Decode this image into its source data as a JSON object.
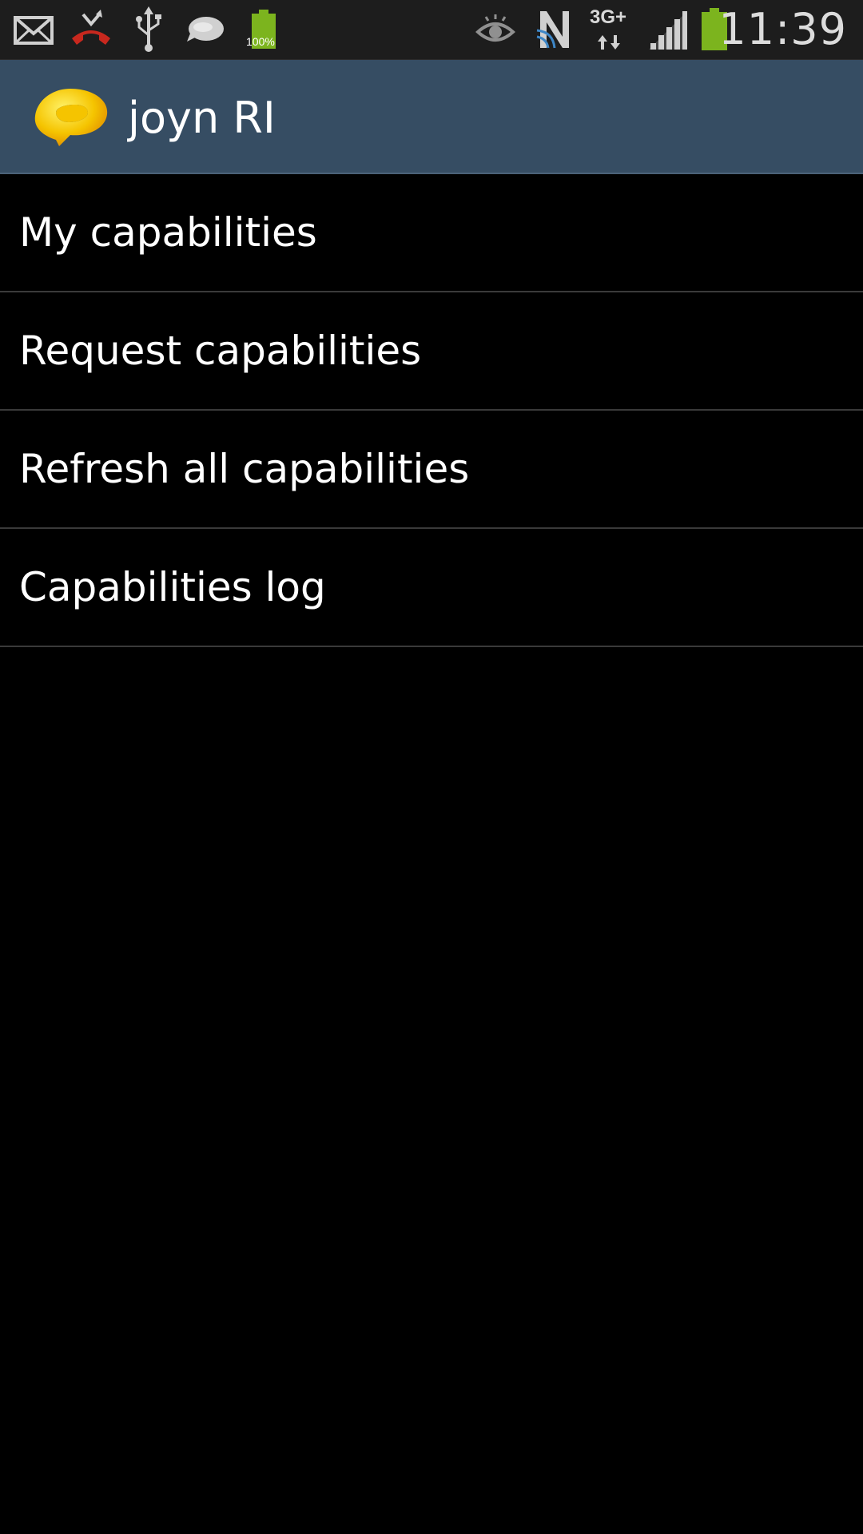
{
  "status_bar": {
    "time": "11:39",
    "battery_percent_label": "100%",
    "network_type": "3G+",
    "left_icons": [
      "mail-icon",
      "missed-call-icon",
      "usb-icon",
      "chat-bubble-icon",
      "battery-full-icon"
    ],
    "right_icons": [
      "eye-icon",
      "nfc-icon",
      "network-data-icon",
      "signal-strength-icon",
      "battery-icon"
    ],
    "colors": {
      "background": "#1d1d1d",
      "battery": "#7cb41e",
      "missed_call": "#c8281e",
      "nfc_arc": "#3d86c6"
    }
  },
  "action_bar": {
    "title": "joyn RI",
    "logo_icon": "joyn-logo-icon",
    "colors": {
      "background": "#364d63",
      "logo": "#f5c400"
    }
  },
  "menu": {
    "items": [
      {
        "label": "My capabilities"
      },
      {
        "label": "Request capabilities"
      },
      {
        "label": "Refresh all capabilities"
      },
      {
        "label": "Capabilities log"
      }
    ]
  }
}
